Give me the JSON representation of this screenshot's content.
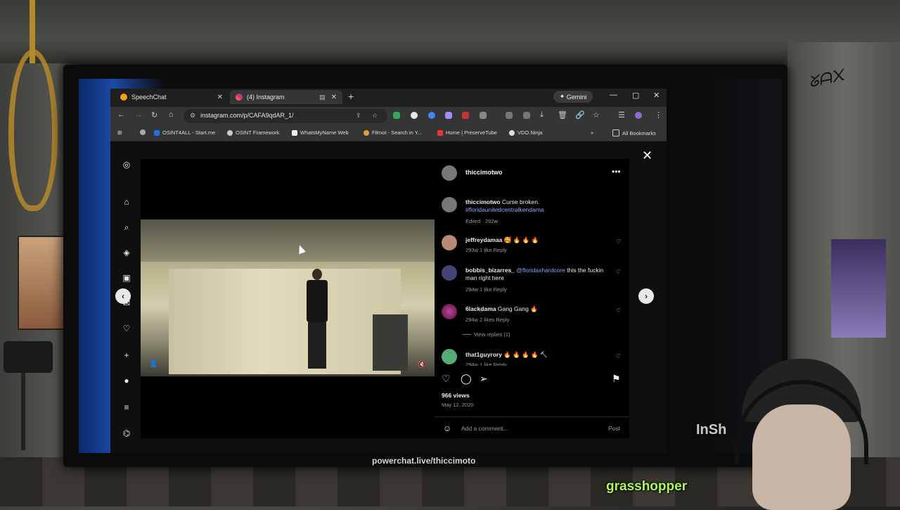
{
  "browser": {
    "tabs": [
      {
        "label": "SpeechChat",
        "active": false
      },
      {
        "label": "(4) Instagram",
        "active": true
      }
    ],
    "gemini_label": "Gemini",
    "url": "instagram.com/p/CAFA9qdAR_1/",
    "bookmarks": [
      "OSINT4ALL - Start.me",
      "OSINT Framework",
      "WhatsMyName Web",
      "Filmot - Search in Y...",
      "Home | PreserveTube",
      "VDO.Ninja"
    ],
    "all_bookmarks": "All Bookmarks"
  },
  "post": {
    "username": "thiccimotwo",
    "caption_user": "thiccimotwo",
    "caption_text": "Curse broken.",
    "caption_tag": "#floridaunitedcentralkendama",
    "caption_meta": "Edited · 292w",
    "comments": [
      {
        "user": "jeffreydamaa",
        "text": "🥰 🔥 🔥 🔥",
        "meta": "293w   1 like   Reply"
      },
      {
        "user": "bobbis_bizarres_",
        "mention": "@floridaxhardcore",
        "text": "this the fuckin man right here",
        "meta": "294w   1 like   Reply"
      },
      {
        "user": "6lackdama",
        "text": "Gang Gang 🔥",
        "meta": "294w   2 likes   Reply"
      },
      {
        "user": "that1guyrory",
        "text": "🔥 🔥 🔥 🔥 🔨",
        "meta": "294w   1 like   Reply"
      }
    ],
    "view_replies": "View replies (1)",
    "views": "966 views",
    "date": "May 12, 2020",
    "add_comment_placeholder": "Add a comment...",
    "post_label": "Post"
  },
  "overlay": {
    "stream_url": "powerchat.live/thiccimoto",
    "name_tag": "grasshopper",
    "desktop_text": "InSh"
  },
  "colors": {
    "ig_link": "#8aa8ff",
    "grasshopper": "#aef55a",
    "browser_dark": "#1f1f1f"
  }
}
